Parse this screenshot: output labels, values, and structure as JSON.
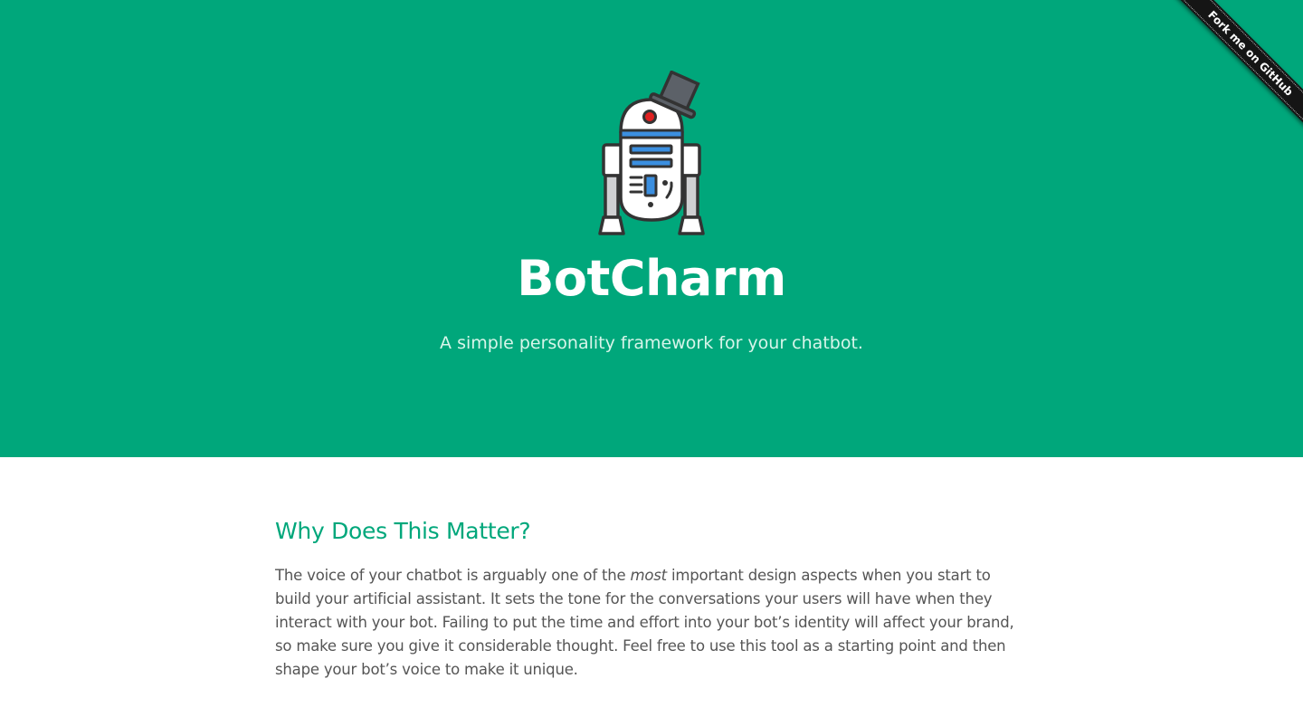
{
  "hero": {
    "logo_icon": "robot-with-top-hat-icon",
    "title": "BotCharm",
    "tagline": "A simple personality framework for your chatbot.",
    "background_color": "#00a77b"
  },
  "ribbon": {
    "label": "Fork me on GitHub",
    "color": "#151515"
  },
  "section": {
    "heading": "Why Does This Matter?",
    "paragraph_before": "The voice of your chatbot is arguably one of the ",
    "paragraph_emphasis": "most",
    "paragraph_after": " important design aspects when you start to build your artificial assistant. It sets the tone for the conversations your users will have when they interact with your bot. Failing to put the time and effort into your bot’s identity will affect your brand, so make sure you give it considerable thought. Feel free to use this tool as a starting point and then shape your bot’s voice to make it unique.",
    "heading_color": "#00a77b"
  }
}
